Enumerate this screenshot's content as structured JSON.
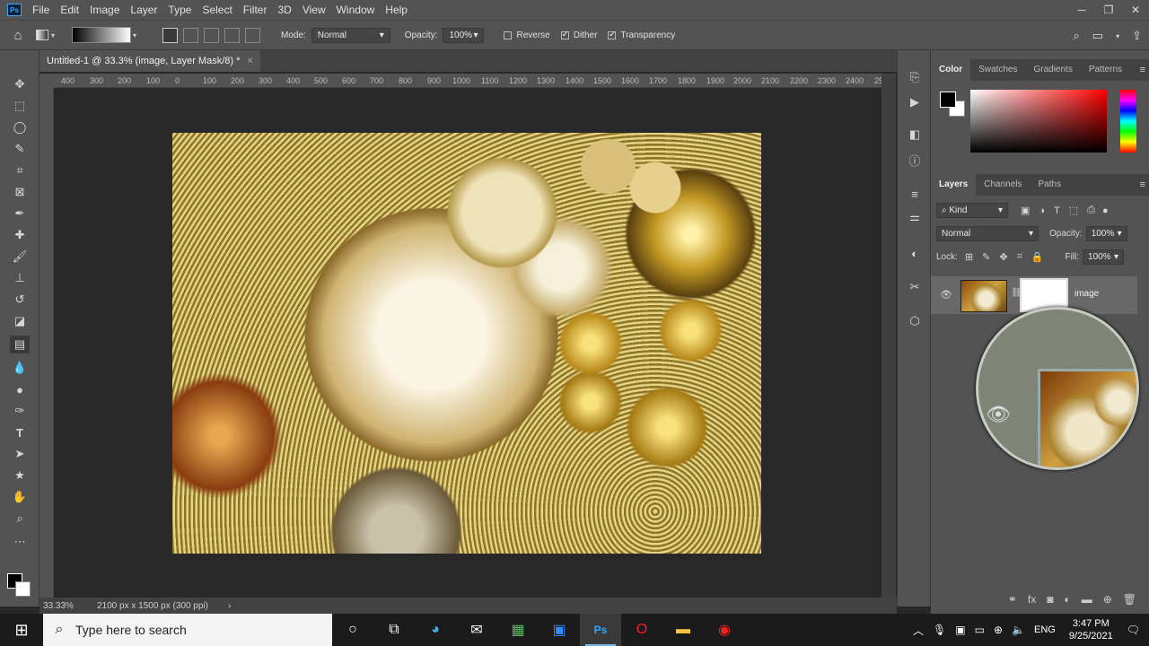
{
  "menubar": {
    "logo": "Ps",
    "items": [
      "File",
      "Edit",
      "Image",
      "Layer",
      "Type",
      "Select",
      "Filter",
      "3D",
      "View",
      "Window",
      "Help"
    ]
  },
  "options": {
    "mode_label": "Mode:",
    "mode_value": "Normal",
    "opacity_label": "Opacity:",
    "opacity_value": "100%",
    "reverse": "Reverse",
    "dither": "Dither",
    "transparency": "Transparency",
    "reverse_checked": false,
    "dither_checked": true,
    "transparency_checked": true
  },
  "document": {
    "tab_title": "Untitled-1 @ 33.3% (image, Layer Mask/8) *",
    "ruler_ticks": [
      "400",
      "300",
      "200",
      "100",
      "0",
      "100",
      "200",
      "300",
      "400",
      "500",
      "600",
      "700",
      "800",
      "900",
      "1000",
      "1100",
      "1200",
      "1300",
      "1400",
      "1500",
      "1600",
      "1700",
      "1800",
      "1900",
      "2000",
      "2100",
      "2200",
      "2300",
      "2400",
      "25"
    ],
    "zoom": "33.33%",
    "doc_info": "2100 px x 1500 px (300 ppi)"
  },
  "color_panel": {
    "tabs": [
      "Color",
      "Swatches",
      "Gradients",
      "Patterns"
    ],
    "foreground": "#000000",
    "background": "#ffffff"
  },
  "layers_panel": {
    "tabs": [
      "Layers",
      "Channels",
      "Paths"
    ],
    "filter_kind": "Kind",
    "blend_mode": "Normal",
    "opacity_label": "Opacity:",
    "opacity_value": "100%",
    "lock_label": "Lock:",
    "fill_label": "Fill:",
    "fill_value": "100%",
    "layer_name": "image"
  },
  "taskbar": {
    "search_placeholder": "Type here to search",
    "language": "ENG",
    "time": "3:47 PM",
    "date": "9/25/2021"
  }
}
